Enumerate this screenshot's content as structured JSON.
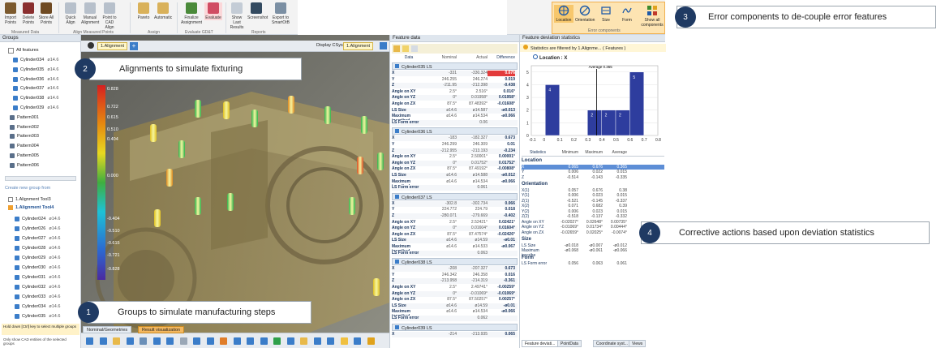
{
  "ribbon": {
    "buttons": [
      {
        "label": "Import Points",
        "sub": "+"
      },
      {
        "label": "Delete Points",
        "sub": "+"
      },
      {
        "label": "Store All Points",
        "sub": ""
      },
      {
        "label": "Quick Align",
        "sub": ""
      },
      {
        "label": "Manual Alignment",
        "sub": ""
      },
      {
        "label": "Point to CAD Align",
        "sub": ""
      },
      {
        "label": "Pareto",
        "sub": ""
      },
      {
        "label": "Automatic",
        "sub": ""
      },
      {
        "label": "Finalize Assignment",
        "sub": "+"
      },
      {
        "label": "Evaluate",
        "sub": ""
      },
      {
        "label": "Show Last Results",
        "sub": ""
      },
      {
        "label": "Screenshot",
        "sub": ""
      },
      {
        "label": "Export to SmartOtB",
        "sub": ""
      }
    ],
    "groups": [
      "Measured Data",
      "Align Measured Points",
      "Assign",
      "Evaluate GD&T",
      "Reports"
    ],
    "error_buttons": [
      "Location",
      "Orientation",
      "Size",
      "Form",
      "Show all components"
    ],
    "error_group": "Error components"
  },
  "callouts": {
    "c1": {
      "num": "1",
      "text": "Groups to simulate manufacturing steps"
    },
    "c2": {
      "num": "2",
      "text": "Alignments to simulate fixturing"
    },
    "c3": {
      "num": "3",
      "text": "Error components to de-couple error features"
    },
    "c4": {
      "num": "4",
      "text": "Corrective actions based upon deviation statistics"
    }
  },
  "groups_panel": {
    "title": "Groups",
    "all_features": "All features",
    "items1": [
      {
        "label": "Cylinder034",
        "val": "ø14.6"
      },
      {
        "label": "Cylinder035",
        "val": "ø14.6"
      },
      {
        "label": "Cylinder036",
        "val": "ø14.6"
      },
      {
        "label": "Cylinder037",
        "val": "ø14.6"
      },
      {
        "label": "Cylinder038",
        "val": "ø14.6"
      },
      {
        "label": "Cylinder039",
        "val": "ø14.6"
      },
      {
        "label": "Pattern001",
        "val": ""
      },
      {
        "label": "Pattern002",
        "val": ""
      },
      {
        "label": "Pattern003",
        "val": ""
      },
      {
        "label": "Pattern004",
        "val": ""
      },
      {
        "label": "Pattern005",
        "val": ""
      },
      {
        "label": "Pattern006",
        "val": ""
      }
    ],
    "create_group": "Create new group from",
    "tool3": "1.Alignment Tool3",
    "tool4": "1.Alignment Tool4",
    "items2": [
      {
        "label": "Cylinder024",
        "val": "ø14.6"
      },
      {
        "label": "Cylinder026",
        "val": "ø14.6"
      },
      {
        "label": "Cylinder027",
        "val": "ø14.6"
      },
      {
        "label": "Cylinder028",
        "val": "ø14.6"
      },
      {
        "label": "Cylinder029",
        "val": "ø14.6"
      },
      {
        "label": "Cylinder030",
        "val": "ø14.6"
      },
      {
        "label": "Cylinder031",
        "val": "ø14.6"
      },
      {
        "label": "Cylinder032",
        "val": "ø14.6"
      },
      {
        "label": "Cylinder033",
        "val": "ø14.6"
      },
      {
        "label": "Cylinder034",
        "val": "ø14.6"
      },
      {
        "label": "Cylinder035",
        "val": "ø14.6"
      }
    ],
    "hint1": "Hold down [Ctrl] key to select multiple groups",
    "hint2": "Only show CAD entities of the selected groups"
  },
  "viewport": {
    "alignment": "1.Alignment",
    "display_label": "Display CSys",
    "display_value": "1.Alignment",
    "scale": [
      "0.828",
      "0.722",
      "0.615",
      "0.510",
      "0.404",
      "0.000",
      "-0.404",
      "-0.510",
      "-0.615",
      "-0.721",
      "-0.828"
    ],
    "tabs": [
      "Nominal/Geometries",
      "Result visualization"
    ]
  },
  "feature_data": {
    "title": "Feature data",
    "cols": [
      "Data",
      "Nominal",
      "Actual",
      "Difference"
    ],
    "blocks": [
      {
        "name": "Cylinder035 LS",
        "rows": [
          [
            "X",
            "-331",
            "-330.324",
            "0.676"
          ],
          [
            "Y",
            "246.255",
            "246.274",
            "0.019"
          ],
          [
            "Z",
            "-211.95",
            "-212.398",
            "-0.438"
          ],
          [
            "Angle on XY",
            "2.5°",
            "2.516°",
            "0.016°"
          ],
          [
            "Angle on YZ",
            "0°",
            "0.01958°",
            "0.01958°"
          ],
          [
            "Angle on ZX",
            "87.5°",
            "87.48392°",
            "-0.01608°"
          ],
          [
            "LS Size",
            "ø14.6",
            "ø14.587",
            "-ø0.013"
          ],
          [
            "Maximum inscribed",
            "ø14.6",
            "ø14.534",
            "-ø0.066"
          ],
          [
            "LS Form error",
            "",
            "0.06",
            ""
          ]
        ]
      },
      {
        "name": "Cylinder036 LS",
        "rows": [
          [
            "X",
            "-183",
            "-182.327",
            "0.673"
          ],
          [
            "Y",
            "246.299",
            "246.309",
            "0.01"
          ],
          [
            "Z",
            "-212.955",
            "-213.193",
            "-0.234"
          ],
          [
            "Angle on XY",
            "2.5°",
            "2.50001°",
            "0.00001°"
          ],
          [
            "Angle on YZ",
            "0°",
            "0.01752°",
            "0.01752°"
          ],
          [
            "Angle on ZX",
            "87.5°",
            "87.49192°",
            "-0.00808°"
          ],
          [
            "LS Size",
            "ø14.6",
            "ø14.588",
            "-ø0.012"
          ],
          [
            "Maximum inscribed",
            "ø14.6",
            "ø14.534",
            "-ø0.066"
          ],
          [
            "LS Form error",
            "",
            "0.061",
            ""
          ]
        ]
      },
      {
        "name": "Cylinder037 LS",
        "rows": [
          [
            "X",
            "-302.8",
            "-302.734",
            "0.066"
          ],
          [
            "Y",
            "224.772",
            "224.79",
            "0.018"
          ],
          [
            "Z",
            "-280.071",
            "-279.669",
            "-0.402"
          ],
          [
            "Angle on XY",
            "2.5°",
            "2.52421°",
            "0.02421°"
          ],
          [
            "Angle on YZ",
            "0°",
            "0.01604°",
            "0.01604°"
          ],
          [
            "Angle on ZX",
            "87.5°",
            "87.47574°",
            "-0.02426°"
          ],
          [
            "LS Size",
            "ø14.6",
            "ø14.59",
            "-ø0.01"
          ],
          [
            "Maximum inscribed",
            "ø14.6",
            "ø14.533",
            "-ø0.067"
          ],
          [
            "LS Form error",
            "",
            "0.063",
            ""
          ]
        ]
      },
      {
        "name": "Cylinder038 LS",
        "rows": [
          [
            "X",
            "-208",
            "-207.327",
            "0.673"
          ],
          [
            "Y",
            "246.342",
            "246.358",
            "0.016"
          ],
          [
            "Z",
            "-213.958",
            "-214.319",
            "-0.361"
          ],
          [
            "Angle on XY",
            "2.5°",
            "2.49741°",
            "-0.00259°"
          ],
          [
            "Angle on YZ",
            "0°",
            "-0.01069°",
            "-0.01069°"
          ],
          [
            "Angle on ZX",
            "87.5°",
            "87.50257°",
            "0.00257°"
          ],
          [
            "LS Size",
            "ø14.6",
            "ø14.59",
            "-ø0.01"
          ],
          [
            "Maximum inscribed",
            "ø14.6",
            "ø14.534",
            "-ø0.066"
          ],
          [
            "LS Form error",
            "",
            "0.062",
            ""
          ]
        ]
      },
      {
        "name": "Cylinder039 LS",
        "rows": [
          [
            "X",
            "-214",
            "-213.935",
            "0.065"
          ]
        ]
      }
    ]
  },
  "deviation": {
    "title": "Feature deviation statistics",
    "filter_text": "Statistics are filtered by 1.Alignme... ( Features )",
    "legend": "Location : X",
    "average_label": "Average 0.365",
    "stats_cols": [
      "Statistics",
      "Minimum",
      "Maximum",
      "Average"
    ],
    "sections": [
      {
        "name": "Location",
        "rows": [
          [
            "X",
            "0.065",
            "0.676",
            "0.365"
          ],
          [
            "Y",
            "0.006",
            "0.022",
            "0.015"
          ],
          [
            "Z",
            "-0.514",
            "-0.143",
            "-0.335"
          ]
        ]
      },
      {
        "name": "Orientation",
        "rows": [
          [
            "X(1)",
            "0.057",
            "0.676",
            "0.38"
          ],
          [
            "Y(1)",
            "0.006",
            "0.023",
            "0.015"
          ],
          [
            "Z(1)",
            "-0.521",
            "-0.145",
            "-0.337"
          ],
          [
            "X(2)",
            "0.071",
            "0.682",
            "0.39"
          ],
          [
            "Y(2)",
            "0.006",
            "0.023",
            "0.015"
          ],
          [
            "Z(2)",
            "-0.518",
            "-0.137",
            "-0.332"
          ],
          [
            "Angle on XY",
            "-0.02027°",
            "0.02648°",
            "0.00735°"
          ],
          [
            "Angle on YZ",
            "-0.01069°",
            "0.01734°",
            "0.00444°"
          ],
          [
            "Angle on ZX",
            "-0.02659°",
            "0.02025°",
            "-0.0074°"
          ]
        ]
      },
      {
        "name": "Size",
        "rows": [
          [
            "LS Size",
            "-ø0.018",
            "-ø0.007",
            "-ø0.012"
          ],
          [
            "Maximum inscribe",
            "-ø0.068",
            "-ø0.061",
            "-ø0.066"
          ]
        ]
      },
      {
        "name": "Form",
        "rows": [
          [
            "LS Form error",
            "0.056",
            "0.063",
            "0.061"
          ]
        ]
      }
    ],
    "bottom_tabs": [
      "Feature deviati...",
      "PointData",
      "Coordinate syst...",
      "Views"
    ],
    "chart_ticks_x": [
      "-0.1",
      "0",
      "0.1",
      "0.2",
      "0.3",
      "0.4",
      "0.5",
      "0.6",
      "0.7",
      "0.8"
    ],
    "chart_ticks_y": [
      "5",
      "4",
      "3",
      "2",
      "1",
      "0"
    ]
  },
  "chart_data": {
    "type": "bar",
    "title": "Location : X",
    "categories": [
      "0.0-0.1",
      "0.1-0.2",
      "0.2-0.3",
      "0.3-0.4",
      "0.4-0.5",
      "0.5-0.6",
      "0.6-0.7"
    ],
    "values": [
      4,
      0,
      0,
      2,
      2,
      2,
      5
    ],
    "xlim": [
      -0.1,
      0.8
    ],
    "ylim": [
      0,
      5.5
    ],
    "annotation": "Average 0.365",
    "color": "#2e3d9e"
  }
}
